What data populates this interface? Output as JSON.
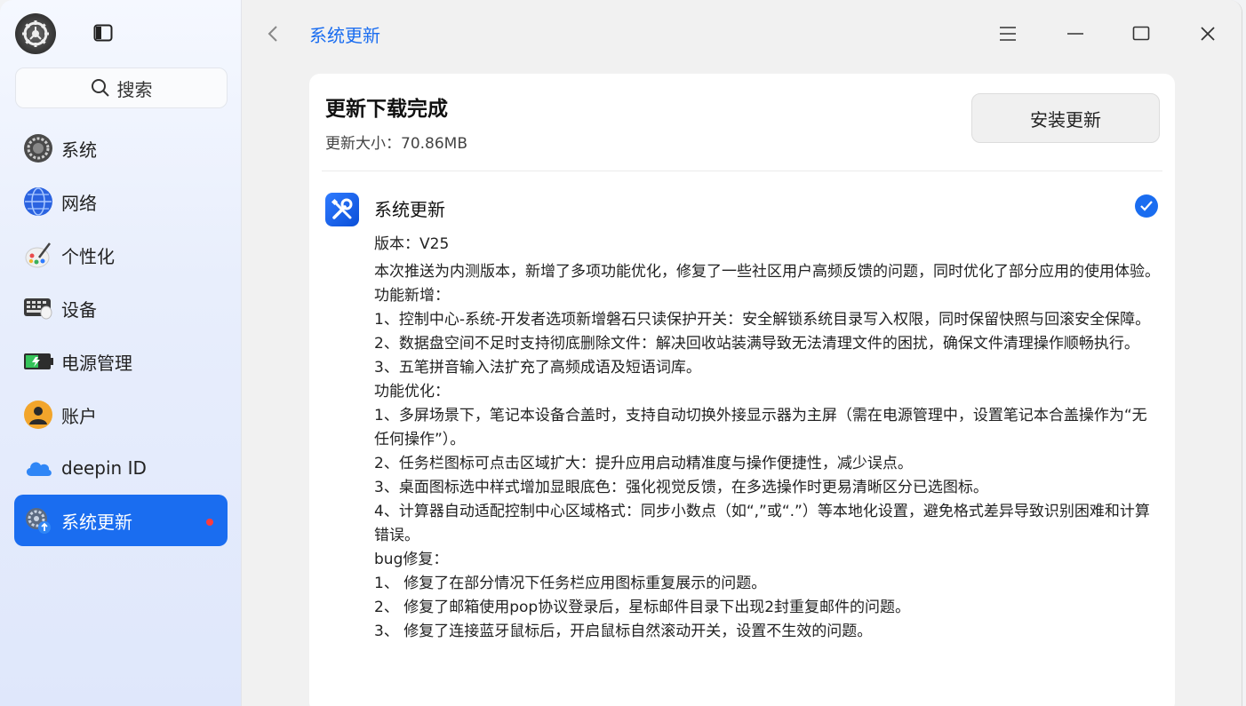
{
  "sidebar": {
    "search_label": "搜索",
    "items": [
      {
        "label": "系统",
        "icon": "system-icon"
      },
      {
        "label": "网络",
        "icon": "network-icon"
      },
      {
        "label": "个性化",
        "icon": "personalization-icon"
      },
      {
        "label": "设备",
        "icon": "device-icon"
      },
      {
        "label": "电源管理",
        "icon": "power-icon"
      },
      {
        "label": "账户",
        "icon": "account-icon"
      },
      {
        "label": "deepin ID",
        "icon": "cloud-icon"
      },
      {
        "label": "系统更新",
        "icon": "update-icon",
        "active": true,
        "badge": true
      }
    ]
  },
  "header": {
    "title": "系统更新"
  },
  "card": {
    "title": "更新下载完成",
    "size": "更新大小：70.86MB",
    "install_label": "安装更新",
    "update_name": "系统更新",
    "version": "版本：V25",
    "notes": [
      "本次推送为内测版本，新增了多项功能优化，修复了一些社区用户高频反馈的问题，同时优化了部分应用的使用体验。",
      "功能新增：",
      "1、控制中心-系统-开发者选项新增磐石只读保护开关：安全解锁系统目录写入权限，同时保留快照与回滚安全保障。",
      "2、数据盘空间不足时支持彻底删除文件：解决回收站装满导致无法清理文件的困扰，确保文件清理操作顺畅执行。",
      "3、五笔拼音输入法扩充了高频成语及短语词库。",
      "功能优化：",
      "1、多屏场景下，笔记本设备合盖时，支持自动切换外接显示器为主屏（需在电源管理中，设置笔记本合盖操作为“无任何操作”）。",
      "2、任务栏图标可点击区域扩大：提升应用启动精准度与操作便捷性，减少误点。",
      "3、桌面图标选中样式增加显眼底色：强化视觉反馈，在多选操作时更易清晰区分已选图标。",
      "4、计算器自动适配控制中心区域格式：同步小数点（如“,”或“.”）等本地化设置，避免格式差异导致识别困难和计算错误。",
      "bug修复：",
      "1、 修复了在部分情况下任务栏应用图标重复展示的问题。",
      "2、 修复了邮箱使用pop协议登录后，星标邮件目录下出现2封重复邮件的问题。",
      "3、 修复了连接蓝牙鼠标后，开启鼠标自然滚动开关，设置不生效的问题。"
    ]
  },
  "colors": {
    "accent": "#1a6df0",
    "badge": "#ff3b3b"
  }
}
